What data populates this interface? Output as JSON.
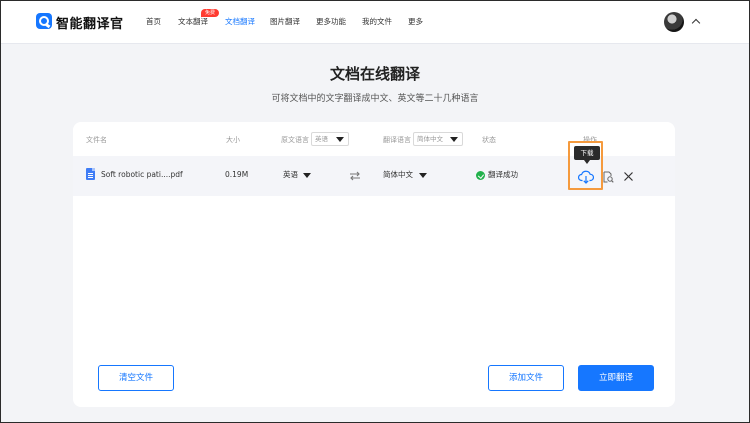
{
  "brand": {
    "name": "智能翻译官",
    "icon": "translate-logo-icon"
  },
  "nav": {
    "items": [
      {
        "label": "首页",
        "active": false
      },
      {
        "label": "文本翻译",
        "active": false,
        "badge": "免费"
      },
      {
        "label": "文档翻译",
        "active": true
      },
      {
        "label": "图片翻译",
        "active": false
      },
      {
        "label": "更多功能",
        "active": false
      },
      {
        "label": "我的文件",
        "active": false
      },
      {
        "label": "更多",
        "active": false
      }
    ]
  },
  "page": {
    "title": "文档在线翻译",
    "subtitle": "可将文档中的文字翻译成中文、英文等二十几种语言"
  },
  "table": {
    "headers": {
      "filename": "文件名",
      "size": "大小",
      "source_lang": "原文语言",
      "source_lang_value": "英语",
      "target_lang": "翻译语言",
      "target_lang_value": "简体中文",
      "status": "状态",
      "actions": "操作"
    },
    "rows": [
      {
        "filename": "Soft robotic pati....pdf",
        "size": "0.19M",
        "source_lang": "英语",
        "target_lang": "简体中文",
        "status": "翻译成功"
      }
    ]
  },
  "tooltip": {
    "download": "下载"
  },
  "buttons": {
    "clear": "清空文件",
    "add": "添加文件",
    "translate": "立即翻译"
  },
  "colors": {
    "accent": "#1677ff",
    "success": "#22b14c",
    "highlight": "#f59a3d",
    "badge": "#ff3b30"
  }
}
